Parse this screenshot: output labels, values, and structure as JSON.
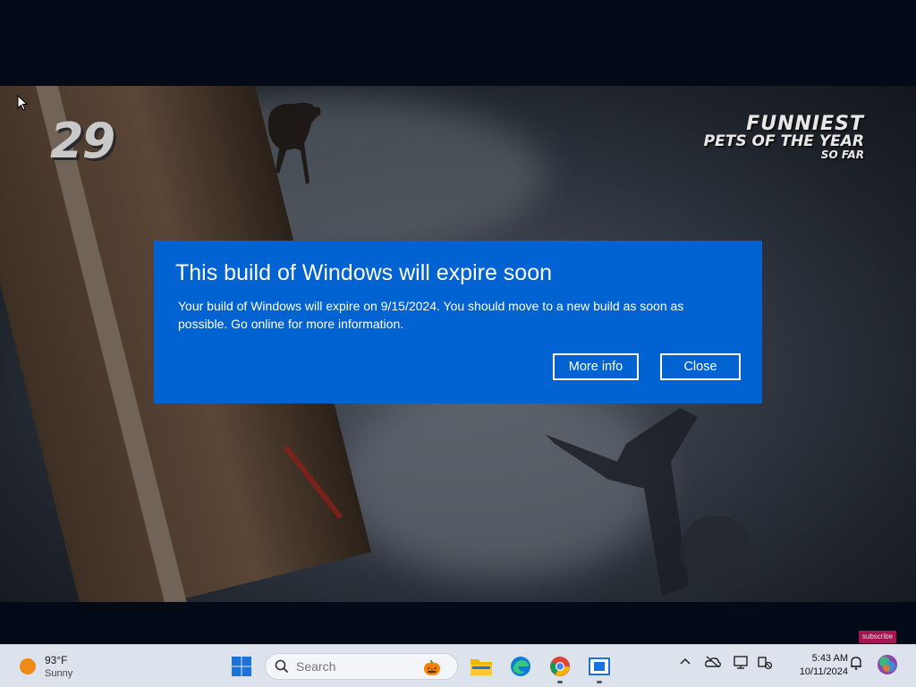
{
  "video": {
    "rank_number": "29",
    "brand_line1": "FUNNIEST",
    "brand_line2": "PETS OF THE YEAR",
    "brand_line3": "SO FAR",
    "subscribe_label": "subscribe"
  },
  "dialog": {
    "title": "This build of Windows will expire soon",
    "body": "Your build of Windows will expire on 9/15/2024. You should move to a new build as soon as possible. Go online for more information.",
    "more_info_label": "More info",
    "close_label": "Close",
    "background_color": "#0063d1"
  },
  "taskbar": {
    "weather": {
      "temperature": "93°F",
      "condition": "Sunny",
      "icon": "sun-icon"
    },
    "search_placeholder": "Search",
    "pinned_apps": [
      "start-icon",
      "file-explorer-icon",
      "edge-icon",
      "chrome-icon",
      "window-app-icon"
    ],
    "tray_icons": [
      "chevron-up-icon",
      "onedrive-icon",
      "monitor-icon",
      "network-icon",
      "notification-bell-icon",
      "copilot-icon"
    ],
    "time": "5:43 AM",
    "date": "10/11/2024"
  }
}
